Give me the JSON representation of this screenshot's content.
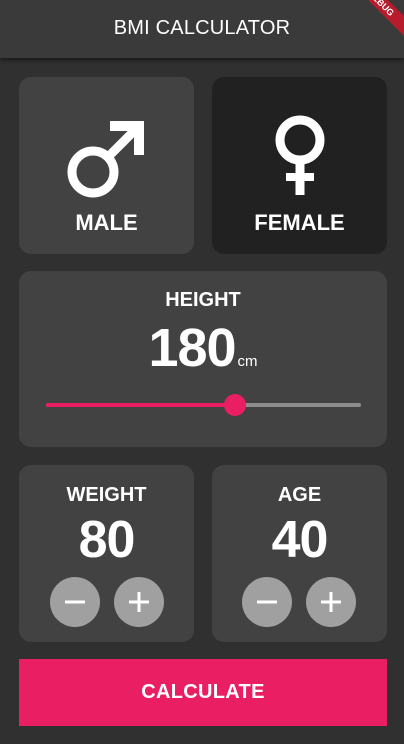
{
  "app": {
    "title": "BMI CALCULATOR",
    "debug_banner": "DEBUG"
  },
  "gender": {
    "selected": "female",
    "male": {
      "label": "MALE",
      "icon": "male-icon"
    },
    "female": {
      "label": "FEMALE",
      "icon": "female-icon"
    }
  },
  "height": {
    "label": "HEIGHT",
    "value": "180",
    "unit": "cm",
    "slider": {
      "min": 120,
      "max": 220,
      "value": 180
    }
  },
  "weight": {
    "label": "WEIGHT",
    "value": "80",
    "decrement_icon": "minus-icon",
    "increment_icon": "plus-icon"
  },
  "age": {
    "label": "AGE",
    "value": "40",
    "decrement_icon": "minus-icon",
    "increment_icon": "plus-icon"
  },
  "calculate": {
    "label": "CALCULATE"
  },
  "colors": {
    "accent": "#e91e63",
    "card_active": "#212121",
    "card_inactive": "#424242",
    "background": "#303030",
    "button": "#a0a0a0"
  }
}
